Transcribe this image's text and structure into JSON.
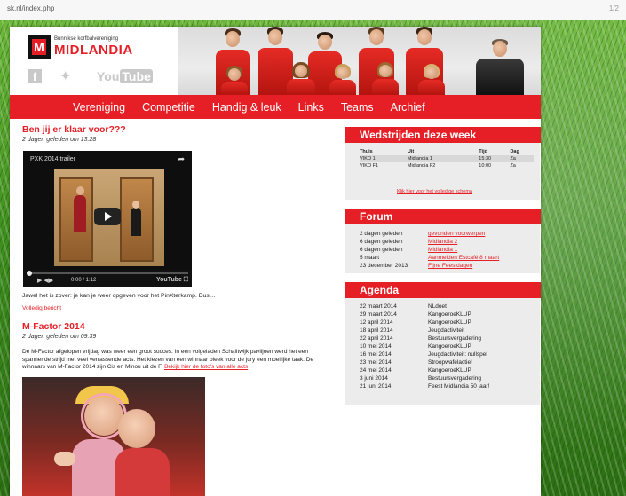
{
  "browser": {
    "url": "sk.nl/index.php",
    "page_indicator": "1/2"
  },
  "header": {
    "club_tagline": "Bunnikse korfbalvereniging",
    "club_name": "MIDLANDIA",
    "logo_letter": "M",
    "social": {
      "facebook": "f",
      "twitter": "✦",
      "youtube_you": "You",
      "youtube_tube": "Tube"
    }
  },
  "nav": [
    "Vereniging",
    "Competitie",
    "Handig & leuk",
    "Links",
    "Teams",
    "Archief"
  ],
  "posts": [
    {
      "title": "Ben jij er klaar voor???",
      "date": "2 dagen geleden om 13:28",
      "video": {
        "title": "PXK 2014 trailer",
        "share": "➦",
        "time": "0:00 / 1:12",
        "controls": "▶  ◀▶",
        "yt": "YouTube  ⛶"
      },
      "excerpt": "Jawel het is zover: je kan je weer opgeven voor het PinXterkamp. Dus…",
      "readmore": "Volledig bericht"
    },
    {
      "title": "M-Factor 2014",
      "date": "2 dagen geleden om 09:39",
      "body": "De M-Factor afgelopen vrijdag was weer een groot succes. In een volgeladen Schalitwijk paviljoen werd het een spannende strijd met veel verrassende acts. Het kiezen van een winnaar bleek voor de jury een moeilijke taak. De winnaars van M-Factor 2014 zijn Cis en Minou uit de F",
      "link": "Bekijk hier de foto's van alle acts"
    }
  ],
  "matches": {
    "title": "Wedstrijden deze week",
    "headers": [
      "Thuis",
      "Uit",
      "Tijd",
      "Dag"
    ],
    "rows": [
      [
        "VIKO 1",
        "Midlandia 1",
        "15:30",
        "Za"
      ],
      [
        "VIKO F1",
        "Midlandia F2",
        "10:00",
        "Za"
      ]
    ],
    "link": "Klik hier voor het volledige schema"
  },
  "forum": {
    "title": "Forum",
    "items": [
      {
        "date": "2 dagen geleden",
        "text": "gevonden voorwerpen"
      },
      {
        "date": "6 dagen geleden",
        "text": "Midlandia 2"
      },
      {
        "date": "6 dagen geleden",
        "text": "Midlandia 1"
      },
      {
        "date": "5 maart",
        "text": "Aanmelden Estcafé 8 maart"
      },
      {
        "date": "23 december 2013",
        "text": "Fijne Feestdagen"
      }
    ]
  },
  "agenda": {
    "title": "Agenda",
    "items": [
      {
        "date": "22 maart 2014",
        "text": "NLdoet"
      },
      {
        "date": "29 maart 2014",
        "text": "KangoeroeKLUP"
      },
      {
        "date": "12 april 2014",
        "text": "KangoeroeKLUP"
      },
      {
        "date": "18 april 2014",
        "text": "Jeugdactiviteit"
      },
      {
        "date": "22 april 2014",
        "text": "Bestuursvergadering"
      },
      {
        "date": "10 mei 2014",
        "text": "KangoeroeKLUP"
      },
      {
        "date": "16 mei 2014",
        "text": "Jeugdactiviteit: nullspel"
      },
      {
        "date": "23 mei 2014",
        "text": "Stroopwafelactie!"
      },
      {
        "date": "24 mei 2014",
        "text": "KangoeroeKLUP"
      },
      {
        "date": "3 juni 2014",
        "text": "Bestuursvergadering"
      },
      {
        "date": "21 juni 2014",
        "text": "Feest Midlandia 50 jaar!"
      }
    ]
  },
  "colors": {
    "brand_red": "#e61e25",
    "panel_grey": "#ececec",
    "grass_green": "#4a9a25"
  }
}
